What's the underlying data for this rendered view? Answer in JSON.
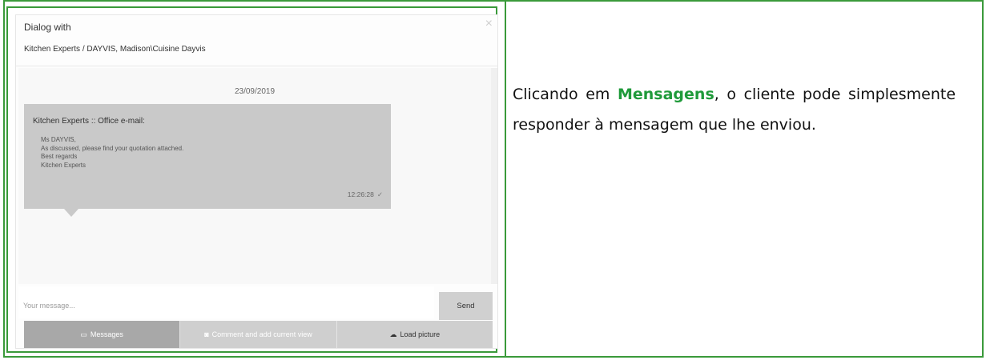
{
  "dialog": {
    "title": "Dialog with",
    "subtitle": "Kitchen Experts / DAYVIS, Madison\\Cuisine Dayvis",
    "close_icon": "×"
  },
  "chat": {
    "date": "23/09/2019",
    "message": {
      "sender": "Kitchen Experts :: Office e-mail:",
      "lines": [
        "Ms DAYVIS,",
        "As discussed, please find your quotation attached.",
        "Best regards",
        "Kitchen Experts"
      ],
      "time": "12:26:28",
      "status_icon": "✓"
    }
  },
  "composer": {
    "placeholder": "Your message...",
    "send_label": "Send"
  },
  "tabs": [
    {
      "label": "Messages",
      "icon": "chat-icon",
      "glyph": "▭"
    },
    {
      "label": "Comment and add current view",
      "icon": "camera-icon",
      "glyph": "◙"
    },
    {
      "label": "Load picture",
      "icon": "upload-icon",
      "glyph": "☁"
    }
  ],
  "description": {
    "before": "Clicando em ",
    "highlight": "Mensagens",
    "after": ", o cliente pode simplesmente responder à mensagem que lhe enviou."
  },
  "colors": {
    "border": "#3a9a3a",
    "highlight": "#1f9a3a",
    "bubble": "#c9c9c9",
    "active_tab": "#a8a8a8"
  }
}
